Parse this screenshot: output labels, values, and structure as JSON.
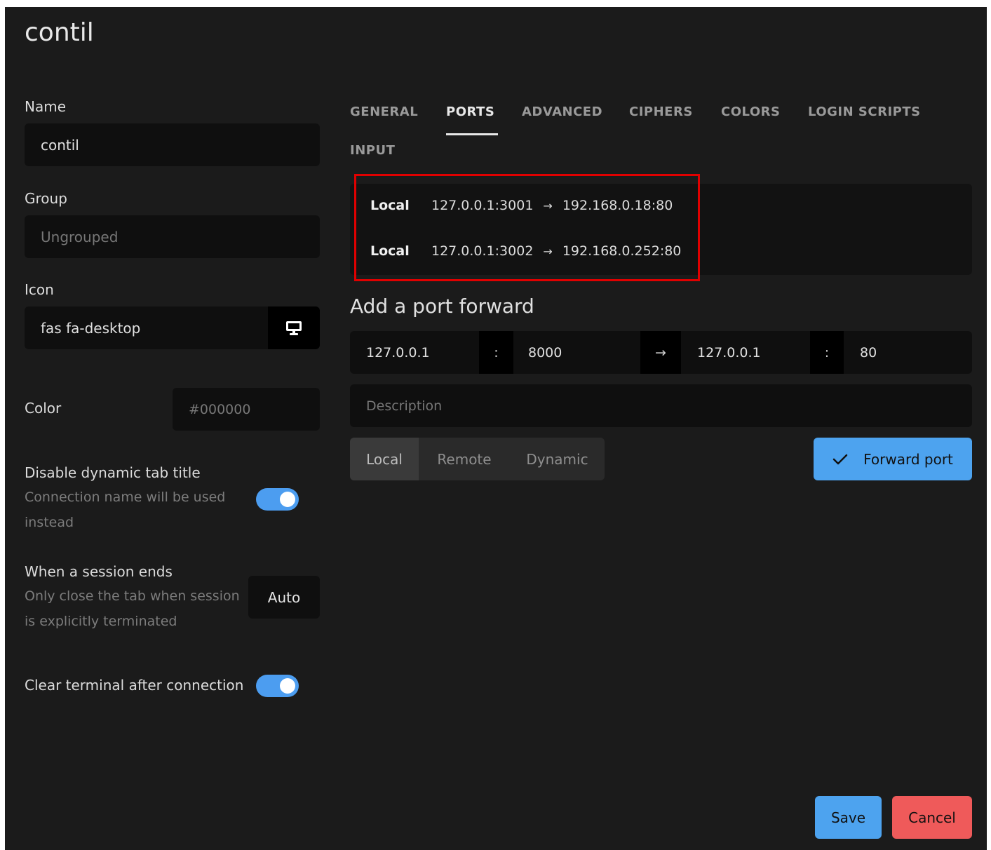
{
  "dialog": {
    "title": "contil"
  },
  "form": {
    "name": {
      "label": "Name",
      "value": "contil"
    },
    "group": {
      "label": "Group",
      "placeholder": "Ungrouped"
    },
    "icon": {
      "label": "Icon",
      "value": "fas fa-desktop",
      "icon_name": "desktop-icon"
    },
    "color": {
      "label": "Color",
      "placeholder": "#000000"
    },
    "dynamic_title": {
      "label": "Disable dynamic tab title",
      "description_line1": "Connection name will be used",
      "description_line2": "instead",
      "enabled": true
    },
    "session_end": {
      "label": "When a session ends",
      "description_line1": "Only close the tab when session",
      "description_line2": "is explicitly terminated",
      "value": "Auto"
    },
    "clear_terminal": {
      "label": "Clear terminal after connection",
      "enabled": true
    }
  },
  "tabs": [
    {
      "label": "GENERAL"
    },
    {
      "label": "PORTS",
      "active": true
    },
    {
      "label": "ADVANCED"
    },
    {
      "label": "CIPHERS"
    },
    {
      "label": "COLORS"
    },
    {
      "label": "LOGIN SCRIPTS"
    },
    {
      "label": "INPUT"
    }
  ],
  "ports": [
    {
      "type": "Local",
      "from": "127.0.0.1:3001",
      "arrow": "→",
      "to": "192.168.0.18:80"
    },
    {
      "type": "Local",
      "from": "127.0.0.1:3002",
      "arrow": "→",
      "to": "192.168.0.252:80"
    }
  ],
  "add_forward": {
    "title": "Add a port forward",
    "local_host": "127.0.0.1",
    "colon": ":",
    "local_port": "8000",
    "arrow": "→",
    "remote_host": "127.0.0.1",
    "remote_port": "80",
    "description_placeholder": "Description",
    "modes": [
      "Local",
      "Remote",
      "Dynamic"
    ],
    "selected_mode": "Local",
    "submit_label": "Forward port"
  },
  "footer": {
    "save_label": "Save",
    "cancel_label": "Cancel"
  },
  "colors": {
    "accent": "#4da3ef",
    "danger": "#ef5a5a",
    "highlight": "#e00000",
    "background": "#1b1b1b"
  }
}
